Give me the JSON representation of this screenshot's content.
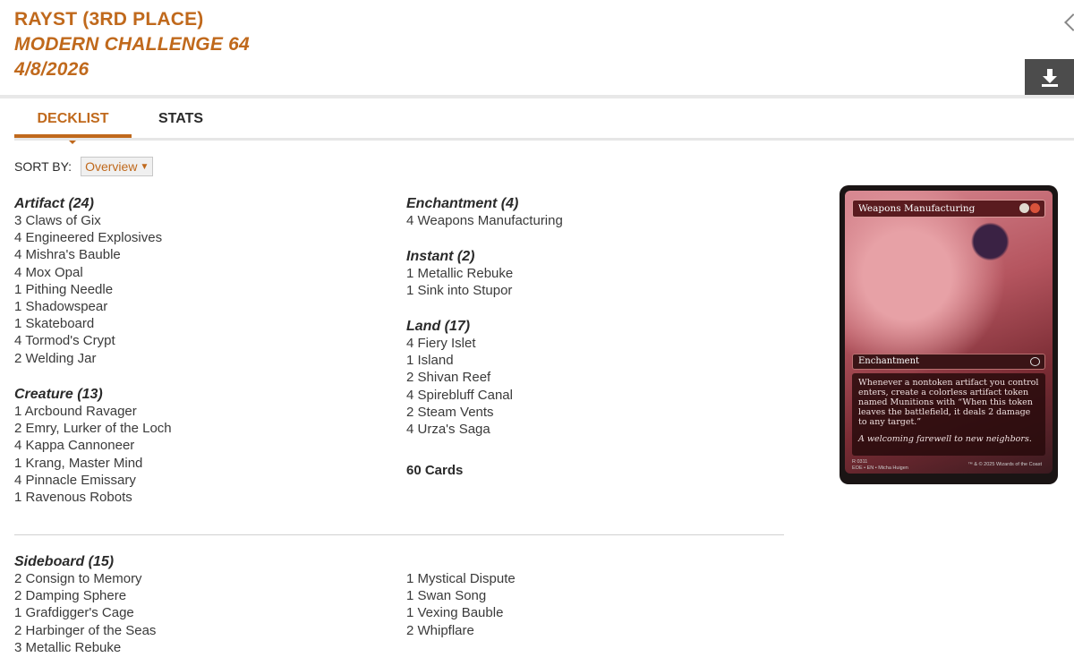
{
  "header": {
    "player": "RAYST (3RD PLACE)",
    "event": "MODERN CHALLENGE 64",
    "date": "4/8/2026"
  },
  "tabs": [
    {
      "label": "DECKLIST"
    },
    {
      "label": "STATS"
    }
  ],
  "sort": {
    "label": "SORT BY:",
    "value": "Overview"
  },
  "icons": {
    "download": "download-icon",
    "corner": "chevron-icon",
    "dropdown": "chevron-down-icon"
  },
  "colors": {
    "accent": "#c0691c",
    "download_bg": "#4c4c4c"
  },
  "main": {
    "artifact": {
      "title": "Artifact (24)",
      "cards": [
        "3 Claws of Gix",
        "4 Engineered Explosives",
        "4 Mishra's Bauble",
        "4 Mox Opal",
        "1 Pithing Needle",
        "1 Shadowspear",
        "1 Skateboard",
        "4 Tormod's Crypt",
        "2 Welding Jar"
      ]
    },
    "creature": {
      "title": "Creature (13)",
      "cards": [
        "1 Arcbound Ravager",
        "2 Emry, Lurker of the Loch",
        "4 Kappa Cannoneer",
        "1 Krang, Master Mind",
        "4 Pinnacle Emissary",
        "1 Ravenous Robots"
      ]
    },
    "enchantment": {
      "title": "Enchantment (4)",
      "cards": [
        "4 Weapons Manufacturing"
      ]
    },
    "instant": {
      "title": "Instant (2)",
      "cards": [
        "1 Metallic Rebuke",
        "1 Sink into Stupor"
      ]
    },
    "land": {
      "title": "Land (17)",
      "cards": [
        "4 Fiery Islet",
        "1 Island",
        "2 Shivan Reef",
        "4 Spirebluff Canal",
        "2 Steam Vents",
        "4 Urza's Saga"
      ]
    },
    "total": "60 Cards"
  },
  "sideboard": {
    "title": "Sideboard (15)",
    "left": [
      "2 Consign to Memory",
      "2 Damping Sphere",
      "1 Grafdigger's Cage",
      "2 Harbinger of the Seas",
      "3 Metallic Rebuke"
    ],
    "right": [
      "1 Mystical Dispute",
      "1 Swan Song",
      "1 Vexing Bauble",
      "2 Whipflare"
    ]
  },
  "card_preview": {
    "name": "Weapons Manufacturing",
    "mana": "1R",
    "type": "Enchantment",
    "rules": "Whenever a nontoken artifact you control enters, create a colorless artifact token named Munitions with “When this token leaves the battlefield, it deals 2 damage to any target.”",
    "flavor": "A welcoming farewell to new neighbors.",
    "collector": "R 0311",
    "set": "EOE • EN",
    "artist": "Micha Huigen",
    "legal": "™ & © 2025 Wizards of the Coast"
  }
}
